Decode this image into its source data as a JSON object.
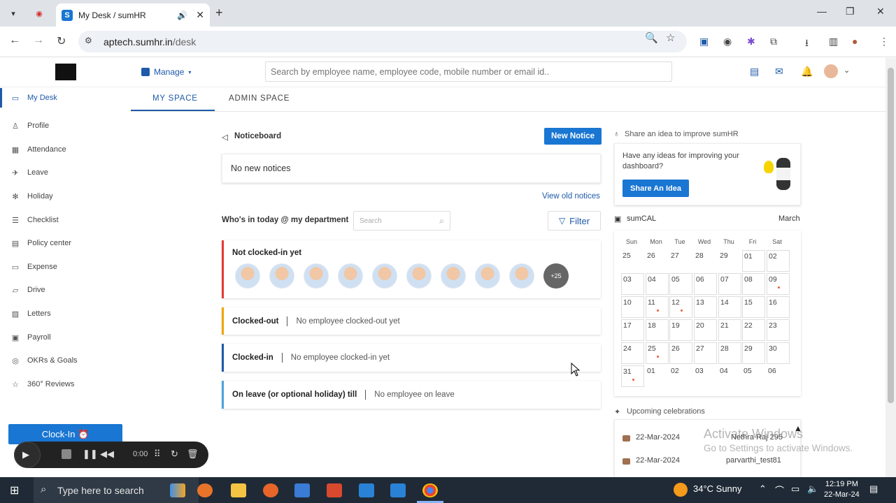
{
  "browser": {
    "tab_title": "My Desk / sumHR",
    "tab_favicon": "S",
    "url_host": "aptech.sumhr.in",
    "url_path": "/desk"
  },
  "header": {
    "manage_label": "Manage",
    "search_placeholder": "Search by employee name, employee code, mobile number or email id.."
  },
  "sidebar": {
    "items": [
      {
        "label": "My Desk",
        "icon": "monitor-icon"
      },
      {
        "label": "Profile",
        "icon": "user-icon"
      },
      {
        "label": "Attendance",
        "icon": "calendar-icon"
      },
      {
        "label": "Leave",
        "icon": "leave-icon"
      },
      {
        "label": "Holiday",
        "icon": "holiday-icon"
      },
      {
        "label": "Checklist",
        "icon": "checklist-icon"
      },
      {
        "label": "Policy center",
        "icon": "policy-icon"
      },
      {
        "label": "Expense",
        "icon": "expense-icon"
      },
      {
        "label": "Drive",
        "icon": "folder-icon"
      },
      {
        "label": "Letters",
        "icon": "letters-icon"
      },
      {
        "label": "Payroll",
        "icon": "payroll-icon"
      },
      {
        "label": "OKRs & Goals",
        "icon": "goals-icon"
      },
      {
        "label": "360° Reviews",
        "icon": "star-icon"
      }
    ],
    "clockin_label": "Clock-In ⏰"
  },
  "recorder": {
    "time": "0:00"
  },
  "tabs": {
    "my_space": "MY SPACE",
    "admin_space": "ADMIN SPACE"
  },
  "noticeboard": {
    "title": "Noticeboard",
    "new_notice": "New Notice",
    "empty": "No new notices",
    "view_old": "View old notices"
  },
  "whos_in": {
    "title": "Who's in today @ my department",
    "search_placeholder": "Search",
    "filter_label": "Filter",
    "not_clocked_in": "Not clocked-in yet",
    "more_count": "+25",
    "clocked_out": "Clocked-out",
    "clocked_out_msg": "No employee clocked-out yet",
    "clocked_in": "Clocked-in",
    "clocked_in_msg": "No employee clocked-in yet",
    "on_leave": "On leave (or optional holiday) till",
    "on_leave_msg": "No employee on leave"
  },
  "idea": {
    "title": "Share an idea to improve sumHR",
    "text": "Have any ideas for improving your dashboard?",
    "button": "Share An Idea"
  },
  "sumcal": {
    "title": "sumCAL",
    "month": "March",
    "weekdays": [
      "Sun",
      "Mon",
      "Tue",
      "Wed",
      "Thu",
      "Fri",
      "Sat"
    ],
    "weeks": [
      [
        "25",
        "26",
        "27",
        "28",
        "29",
        "01",
        "02"
      ],
      [
        "03",
        "04",
        "05",
        "06",
        "07",
        "08",
        "09"
      ],
      [
        "10",
        "11",
        "12",
        "13",
        "14",
        "15",
        "16"
      ],
      [
        "17",
        "18",
        "19",
        "20",
        "21",
        "22",
        "23"
      ],
      [
        "24",
        "25",
        "26",
        "27",
        "28",
        "29",
        "30"
      ],
      [
        "31",
        "01",
        "02",
        "03",
        "04",
        "05",
        "06"
      ]
    ],
    "event_days": [
      "09",
      "11",
      "12",
      "25",
      "31"
    ]
  },
  "celebrations": {
    "title": "Upcoming celebrations",
    "items": [
      {
        "date": "22-Mar-2024",
        "name": "Nethra Raj 295"
      },
      {
        "date": "22-Mar-2024",
        "name": "parvarthi_test81"
      }
    ]
  },
  "watermark": {
    "line1": "Activate Windows",
    "line2": "Go to Settings to activate Windows."
  },
  "taskbar": {
    "search_placeholder": "Type here to search",
    "weather": "34°C  Sunny",
    "time": "12:19 PM",
    "date": "22-Mar-24"
  },
  "colors": {
    "accent": "#1976d2",
    "red": "#e53935",
    "amber": "#f0a500",
    "blue_border": "#1e5aa8"
  }
}
